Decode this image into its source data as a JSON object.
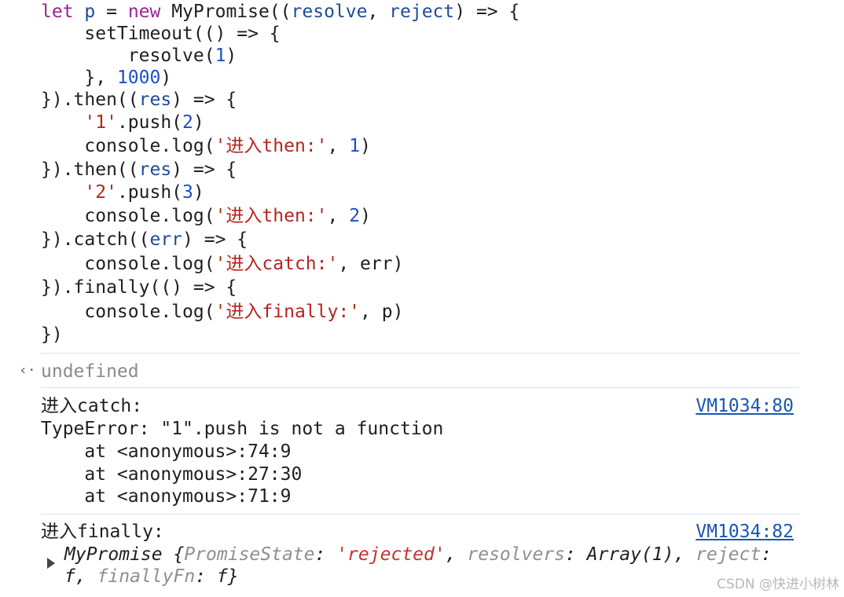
{
  "code": {
    "line1": {
      "kw1": "let",
      "var1": "p",
      "op1": " = ",
      "kw2": "new",
      "text1": " MyPromise((",
      "var2": "resolve",
      "text2": ", ",
      "var3": "reject",
      "text3": ") => {"
    },
    "line2": {
      "text": "    setTimeout(() => {"
    },
    "line3": {
      "text1": "        resolve(",
      "num": "1",
      "text2": ")"
    },
    "line4": {
      "text1": "    }, ",
      "num": "1000",
      "text2": ")"
    },
    "line5": {
      "text1": "}).then((",
      "var": "res",
      "text2": ") => {"
    },
    "line6": {
      "indent": "    ",
      "str": "'1'",
      "text1": ".push(",
      "num": "2",
      "text2": ")"
    },
    "line7": {
      "text1": "    console.log(",
      "str": "'进入then:'",
      "text2": ", ",
      "num": "1",
      "text3": ")"
    },
    "line8": {
      "text1": "}).then((",
      "var": "res",
      "text2": ") => {"
    },
    "line9": {
      "indent": "    ",
      "str": "'2'",
      "text1": ".push(",
      "num": "3",
      "text2": ")"
    },
    "line10": {
      "text1": "    console.log(",
      "str": "'进入then:'",
      "text2": ", ",
      "num": "2",
      "text3": ")"
    },
    "line11": {
      "text1": "}).catch((",
      "var": "err",
      "text2": ") => {"
    },
    "line12": {
      "text1": "    console.log(",
      "str": "'进入catch:'",
      "text2": ", err)"
    },
    "line13": {
      "text": "}).finally(() => {"
    },
    "line14": {
      "text1": "    console.log(",
      "str": "'进入finally:'",
      "text2": ", p)"
    },
    "line15": {
      "text": "})"
    }
  },
  "return_value": {
    "arrow": "‹·",
    "text": "undefined"
  },
  "catch_log": {
    "label": "进入catch:",
    "source": "VM1034:80",
    "error": "TypeError: \"1\".push is not a function",
    "stack": [
      "    at <anonymous>:74:9",
      "    at <anonymous>:27:30",
      "    at <anonymous>:71:9"
    ]
  },
  "finally_log": {
    "label": "进入finally:",
    "source": "VM1034:82",
    "object": {
      "name": "MyPromise",
      "open": " {",
      "key1": "PromiseState",
      "colon1": ": ",
      "val1": "'rejected'",
      "sep1": ", ",
      "key2": "resolvers",
      "colon2": ": ",
      "val2": "Array(1)",
      "sep2": ", ",
      "key3": "reject",
      "colon3": ":",
      "val3": "f",
      "sep3": ", ",
      "key4": "finallyFn",
      "colon4": ": ",
      "val4": "f",
      "close": "}"
    }
  },
  "watermark": "CSDN @快进小树林",
  "colors": {
    "keyword": "#9b2393",
    "variable": "#1f4b99",
    "number": "#1c4fc7",
    "string": "#b3261e",
    "link": "#1a57b5",
    "separator": "#d9e1ec"
  }
}
